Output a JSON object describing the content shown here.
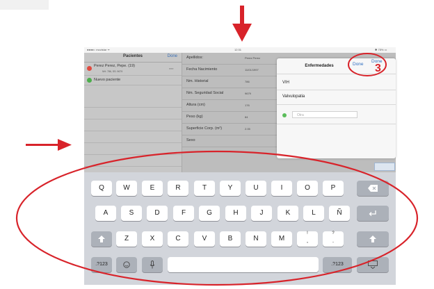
{
  "statusbar": {
    "carrier": "●●●●○ movistar ᯤ",
    "time": "12:31",
    "battery": "✱ 75% ▭"
  },
  "sidebar": {
    "title": "Pacientes",
    "done_label": "Done",
    "items": [
      {
        "name": "Perez Perez, Pepe. (19)",
        "sub": "NH: 786, SS: 9679",
        "badge": "■■■",
        "status_color": "#e04a3f"
      },
      {
        "name": "Nuevo paciente",
        "status_color": "#4cae4c"
      }
    ]
  },
  "form": {
    "fields": [
      {
        "label": "Apellidos:",
        "value": "Perez Perez"
      },
      {
        "label": "Fecha Nacimiento",
        "value": "11/01/1997"
      },
      {
        "label": "Nm. Historial",
        "value": "786"
      },
      {
        "label": "Nm. Seguridad Social",
        "value": "9679"
      },
      {
        "label": "Altura (cm)",
        "value": "176"
      },
      {
        "label": "Peso (kg)",
        "value": "84"
      },
      {
        "label": "Superficie Corp. (m²)",
        "value": "2.05"
      },
      {
        "label": "Sexo",
        "value": ""
      }
    ]
  },
  "popover": {
    "title": "Enfermedades",
    "done_label": "Done",
    "items": [
      "VIH",
      "Valvulopatia"
    ],
    "input_placeholder": "Otra"
  },
  "detail": {
    "done_label": "Done"
  },
  "annotations": {
    "step_number": "3",
    "color": "#d8232a"
  },
  "keyboard": {
    "row1": [
      "Q",
      "W",
      "E",
      "R",
      "T",
      "Y",
      "U",
      "I",
      "O",
      "P"
    ],
    "row2": [
      "A",
      "S",
      "D",
      "F",
      "G",
      "H",
      "J",
      "K",
      "L",
      "Ñ"
    ],
    "row3": [
      "Z",
      "X",
      "C",
      "V",
      "B",
      "N",
      "M"
    ],
    "row3_punct": [
      {
        "top": "!",
        "bottom": ","
      },
      {
        "top": "?",
        "bottom": "."
      }
    ],
    "numbers_label": ".?123",
    "icons": {
      "backspace": "backspace-icon",
      "return": "return-icon",
      "shift": "shift-icon",
      "emoji": "emoji-icon",
      "mic": "microphone-icon",
      "dismiss": "keyboard-dismiss-icon"
    }
  }
}
